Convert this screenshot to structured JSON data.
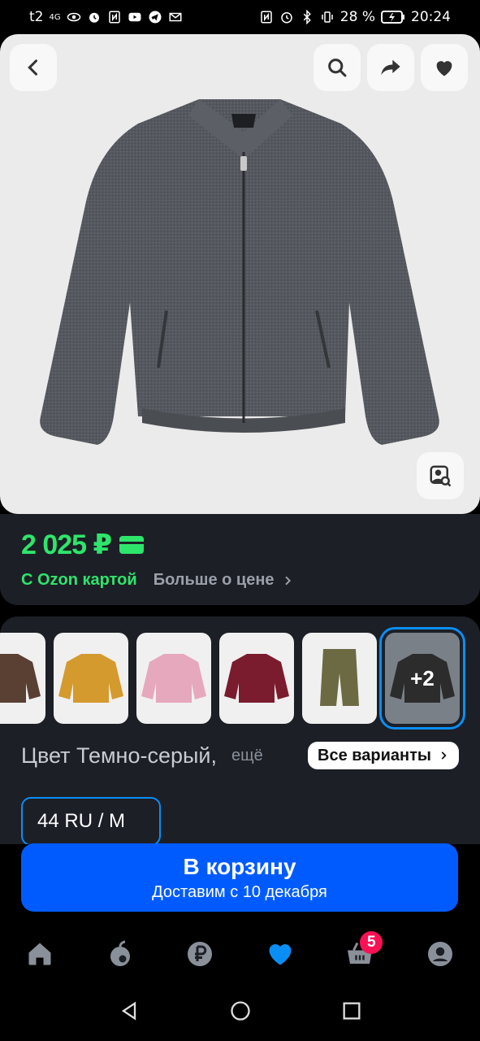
{
  "status_bar": {
    "carrier": "t2",
    "network": "4G",
    "battery": "28 %",
    "time": "20:24"
  },
  "hero": {
    "back_icon": "chevron-left-icon",
    "search_icon": "search-icon",
    "share_icon": "share-arrow-icon",
    "favorite_icon": "heart-icon",
    "visual_search_icon": "image-search-icon"
  },
  "price": {
    "value": "2 025 ₽",
    "ozon_card_label": "С Ozon картой",
    "more_label": "Больше о цене"
  },
  "variants": {
    "thumbs": [
      {
        "name": "brown",
        "color": "#5a3f33"
      },
      {
        "name": "mustard",
        "color": "#d49a2e"
      },
      {
        "name": "pink",
        "color": "#e6a8bc"
      },
      {
        "name": "burgundy",
        "color": "#7a1c2d"
      },
      {
        "name": "olive-shorts",
        "color": "#6b6a43"
      },
      {
        "name": "black",
        "color": "#2c2c2c",
        "more": "+2"
      }
    ],
    "color_label": "Цвет Темно-серый,",
    "color_more": "ещё",
    "all_variants_label": "Все варианты",
    "size": "44 RU / M"
  },
  "cart": {
    "title": "В корзину",
    "subtitle": "Доставим с 10 декабря"
  },
  "tabbar": {
    "cart_badge": "5",
    "tabs": [
      "home-icon",
      "fresh-icon",
      "ruble-icon",
      "favorites-icon",
      "cart-icon",
      "profile-icon"
    ]
  },
  "colors": {
    "accent_green": "#2ee56b",
    "accent_blue": "#005bff",
    "selected_outline": "#0a8ef5",
    "card_bg": "#1c1f26",
    "badge": "#f91155"
  }
}
